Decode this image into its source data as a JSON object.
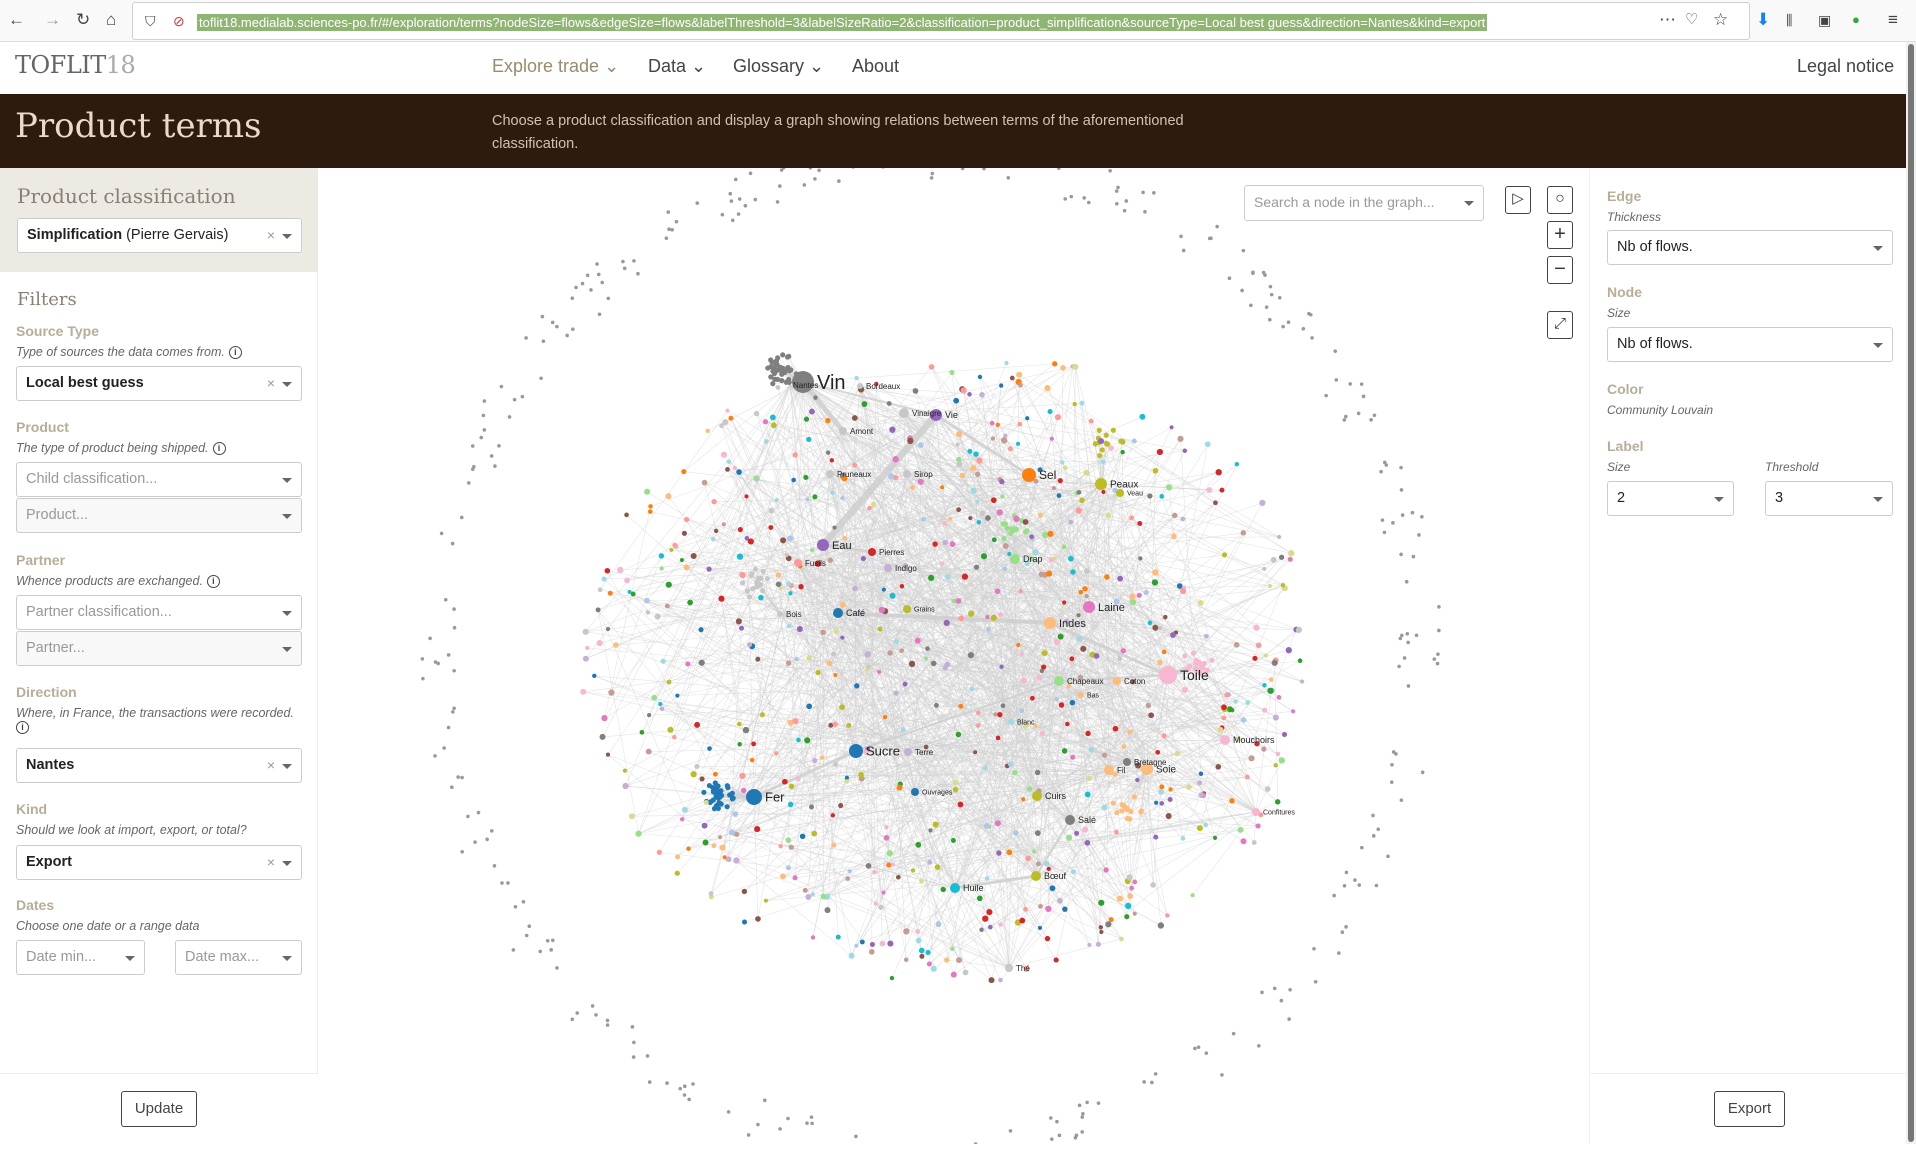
{
  "browser": {
    "url": "toflit18.medialab.sciences-po.fr/#/exploration/terms?nodeSize=flows&edgeSize=flows&labelThreshold=3&labelSizeRatio=2&classification=product_simplification&sourceType=Local best guess&direction=Nantes&kind=export"
  },
  "nav": {
    "logo_main": "TOFLIT",
    "logo_num": "18",
    "items": [
      {
        "label": "Explore trade",
        "dropdown": true
      },
      {
        "label": "Data",
        "dropdown": true
      },
      {
        "label": "Glossary",
        "dropdown": true
      },
      {
        "label": "About",
        "dropdown": false
      }
    ],
    "legal": "Legal notice"
  },
  "banner": {
    "title": "Product terms",
    "description": "Choose a product classification and display a graph showing relations between terms of the aforementioned classification."
  },
  "left": {
    "classification_title": "Product classification",
    "classification_value_bold": "Simplification",
    "classification_value_rest": " (Pierre Gervais)",
    "filters_title": "Filters",
    "source_type": {
      "label": "Source Type",
      "help": "Type of sources the data comes from.",
      "value": "Local best guess"
    },
    "product": {
      "label": "Product",
      "help": "The type of product being shipped.",
      "placeholder1": "Child classification...",
      "placeholder2": "Product..."
    },
    "partner": {
      "label": "Partner",
      "help": "Whence products are exchanged.",
      "placeholder1": "Partner classification...",
      "placeholder2": "Partner..."
    },
    "direction": {
      "label": "Direction",
      "help": "Where, in France, the transactions were recorded.",
      "value": "Nantes"
    },
    "kind": {
      "label": "Kind",
      "help": "Should we look at import, export, or total?",
      "value": "Export"
    },
    "dates": {
      "label": "Dates",
      "help": "Choose one date or a range data",
      "min_placeholder": "Date min...",
      "max_placeholder": "Date max..."
    },
    "update": "Update",
    "info_glyph": "i",
    "clear_glyph": "×"
  },
  "graph": {
    "search_placeholder": "Search a node in the graph...",
    "node_color_default": "#c7c7c7",
    "edge_color": "#d0d0d0",
    "palette": [
      "#1f77b4",
      "#aec7e8",
      "#ff7f0e",
      "#ffbb78",
      "#2ca02c",
      "#98df8a",
      "#d62728",
      "#ff9896",
      "#9467bd",
      "#c5b0d5",
      "#8c564b",
      "#c49c94",
      "#e377c2",
      "#f7b6d2",
      "#7f7f7f",
      "#c7c7c7",
      "#bcbd22",
      "#dbdb8d",
      "#17becf",
      "#9edae5"
    ],
    "labeled_nodes": [
      {
        "label": "Vin",
        "color": "#7f7f7f"
      },
      {
        "label": "Nantes",
        "color": "#7f7f7f"
      },
      {
        "label": "Bordeaux",
        "color": "#c7c7c7"
      },
      {
        "label": "Vinaigre",
        "color": "#c7c7c7"
      },
      {
        "label": "Vie",
        "color": "#9467bd"
      },
      {
        "label": "Amont",
        "color": "#c7c7c7"
      },
      {
        "label": "Pruneaux",
        "color": "#c7c7c7"
      },
      {
        "label": "Sirop",
        "color": "#c7c7c7"
      },
      {
        "label": "Sel",
        "color": "#ff7f0e"
      },
      {
        "label": "Peaux",
        "color": "#bcbd22"
      },
      {
        "label": "Veau",
        "color": "#bcbd22"
      },
      {
        "label": "Eau",
        "color": "#9467bd"
      },
      {
        "label": "Pierres",
        "color": "#d62728"
      },
      {
        "label": "Fusils",
        "color": "#ff9896"
      },
      {
        "label": "Indigo",
        "color": "#c5b0d5"
      },
      {
        "label": "Drap",
        "color": "#98df8a"
      },
      {
        "label": "Bois",
        "color": "#c7c7c7"
      },
      {
        "label": "Café",
        "color": "#1f77b4"
      },
      {
        "label": "Grains",
        "color": "#bcbd22"
      },
      {
        "label": "Laine",
        "color": "#e377c2"
      },
      {
        "label": "Indes",
        "color": "#ffbb78"
      },
      {
        "label": "Chapeaux",
        "color": "#98df8a"
      },
      {
        "label": "Coton",
        "color": "#ffbb78"
      },
      {
        "label": "Bas",
        "color": "#ffbb78"
      },
      {
        "label": "Toile",
        "color": "#f7b6d2"
      },
      {
        "label": "Blanc",
        "color": "#9edae5"
      },
      {
        "label": "Sucre",
        "color": "#1f77b4"
      },
      {
        "label": "Terre",
        "color": "#c5b0d5"
      },
      {
        "label": "Fer",
        "color": "#1f77b4"
      },
      {
        "label": "Ouvrages",
        "color": "#1f77b4"
      },
      {
        "label": "Mouchoirs",
        "color": "#f7b6d2"
      },
      {
        "label": "Bretagne",
        "color": "#7f7f7f"
      },
      {
        "label": "Fil",
        "color": "#ffbb78"
      },
      {
        "label": "Soie",
        "color": "#ffbb78"
      },
      {
        "label": "Confitures",
        "color": "#f7b6d2"
      },
      {
        "label": "Cuirs",
        "color": "#bcbd22"
      },
      {
        "label": "Salé",
        "color": "#7f7f7f"
      },
      {
        "label": "Bœuf",
        "color": "#bcbd22"
      },
      {
        "label": "Huile",
        "color": "#17becf"
      },
      {
        "label": "Thé",
        "color": "#c7c7c7"
      }
    ]
  },
  "right": {
    "edge": {
      "label": "Edge",
      "sub": "Thickness",
      "value": "Nb of flows."
    },
    "node": {
      "label": "Node",
      "sub": "Size",
      "value": "Nb of flows."
    },
    "color": {
      "label": "Color",
      "sub": "Community Louvain"
    },
    "label": {
      "label": "Label",
      "size_label": "Size",
      "size_value": "2",
      "threshold_label": "Threshold",
      "threshold_value": "3"
    },
    "export": "Export"
  }
}
